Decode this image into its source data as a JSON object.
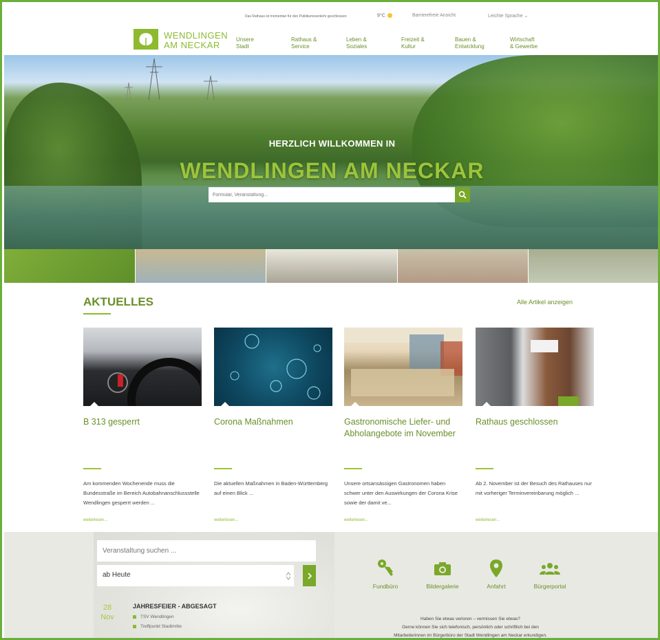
{
  "utility": {
    "notice": "Das Rathaus ist momentan für den Publikumsverkehr geschlossen",
    "weather": "9°C",
    "accessibility": "Barrierefreie Ansicht",
    "language": "Leichte Sprache"
  },
  "header": {
    "logo_line1": "WENDLINGEN",
    "logo_line2": "AM NECKAR",
    "nav": [
      {
        "line1": "Unsere",
        "line2": "Stadt"
      },
      {
        "line1": "Rathaus &",
        "line2": "Service"
      },
      {
        "line1": "Leben &",
        "line2": "Soziales"
      },
      {
        "line1": "Freizeit &",
        "line2": "Kultur"
      },
      {
        "line1": "Bauen &",
        "line2": "Entwicklung"
      },
      {
        "line1": "Wirtschaft",
        "line2": "& Gewerbe"
      }
    ]
  },
  "hero": {
    "welcome": "HERZLICH WILLKOMMEN IN",
    "town": "WENDLINGEN AM NECKAR",
    "search_placeholder": "Formular, Veranstaltung..."
  },
  "news": {
    "title": "AKTUELLES",
    "all_link": "Alle Artikel anzeigen",
    "more_label": "weiterlesen...",
    "cards": [
      {
        "title": "B 313 gesperrt",
        "text": "Am kommenden Wochenende muss die Bundesstraße im Bereich Autobahnanschlussstelle Wendlingen gesperrt werden ..."
      },
      {
        "title": "Corona Maßnahmen",
        "text": "Die aktuellen Maßnahmen in Baden-Württemberg auf einen Blick ..."
      },
      {
        "title": "Gastronomische Liefer- und Abholangebote im November",
        "text": "Unsere ortsansässigen Gastronomen haben schwer unter den Auswirkungen der Corona Krise sowie der damit ve..."
      },
      {
        "title": "Rathaus geschlossen",
        "text": "Ab 2. November ist der Besuch des Rathauses nur mit vorheriger Terminvereinbarung möglich ..."
      }
    ]
  },
  "events": {
    "search_placeholder": "Veranstaltung suchen ...",
    "select_value": "ab Heute",
    "event": {
      "day": "28",
      "month": "Nov",
      "title": "JAHRESFEIER - ABGESAGT",
      "organizer": "TSV Wendlingen",
      "location": "Treffpunkt Stadtmitte"
    }
  },
  "quicklinks": [
    {
      "label": "Fundbüro",
      "icon": "keys-icon"
    },
    {
      "label": "Bildergalerie",
      "icon": "camera-icon"
    },
    {
      "label": "Anfahrt",
      "icon": "map-pin-icon"
    },
    {
      "label": "Bürgerportal",
      "icon": "people-icon"
    }
  ],
  "info": {
    "line1": "Haben Sie etwas verloren – vermissen Sie etwas?",
    "line2": "Gerne können Sie sich telefonisch, persönlich oder schriftlich bei den",
    "line3": "Mitarbeiterinnen im Bürgerbüro der Stadt Wendlingen am Neckar erkundigen."
  },
  "colors": {
    "brand_green": "#8dba2f",
    "text_green": "#6a8f2a",
    "frame_green": "#6cae3c"
  }
}
